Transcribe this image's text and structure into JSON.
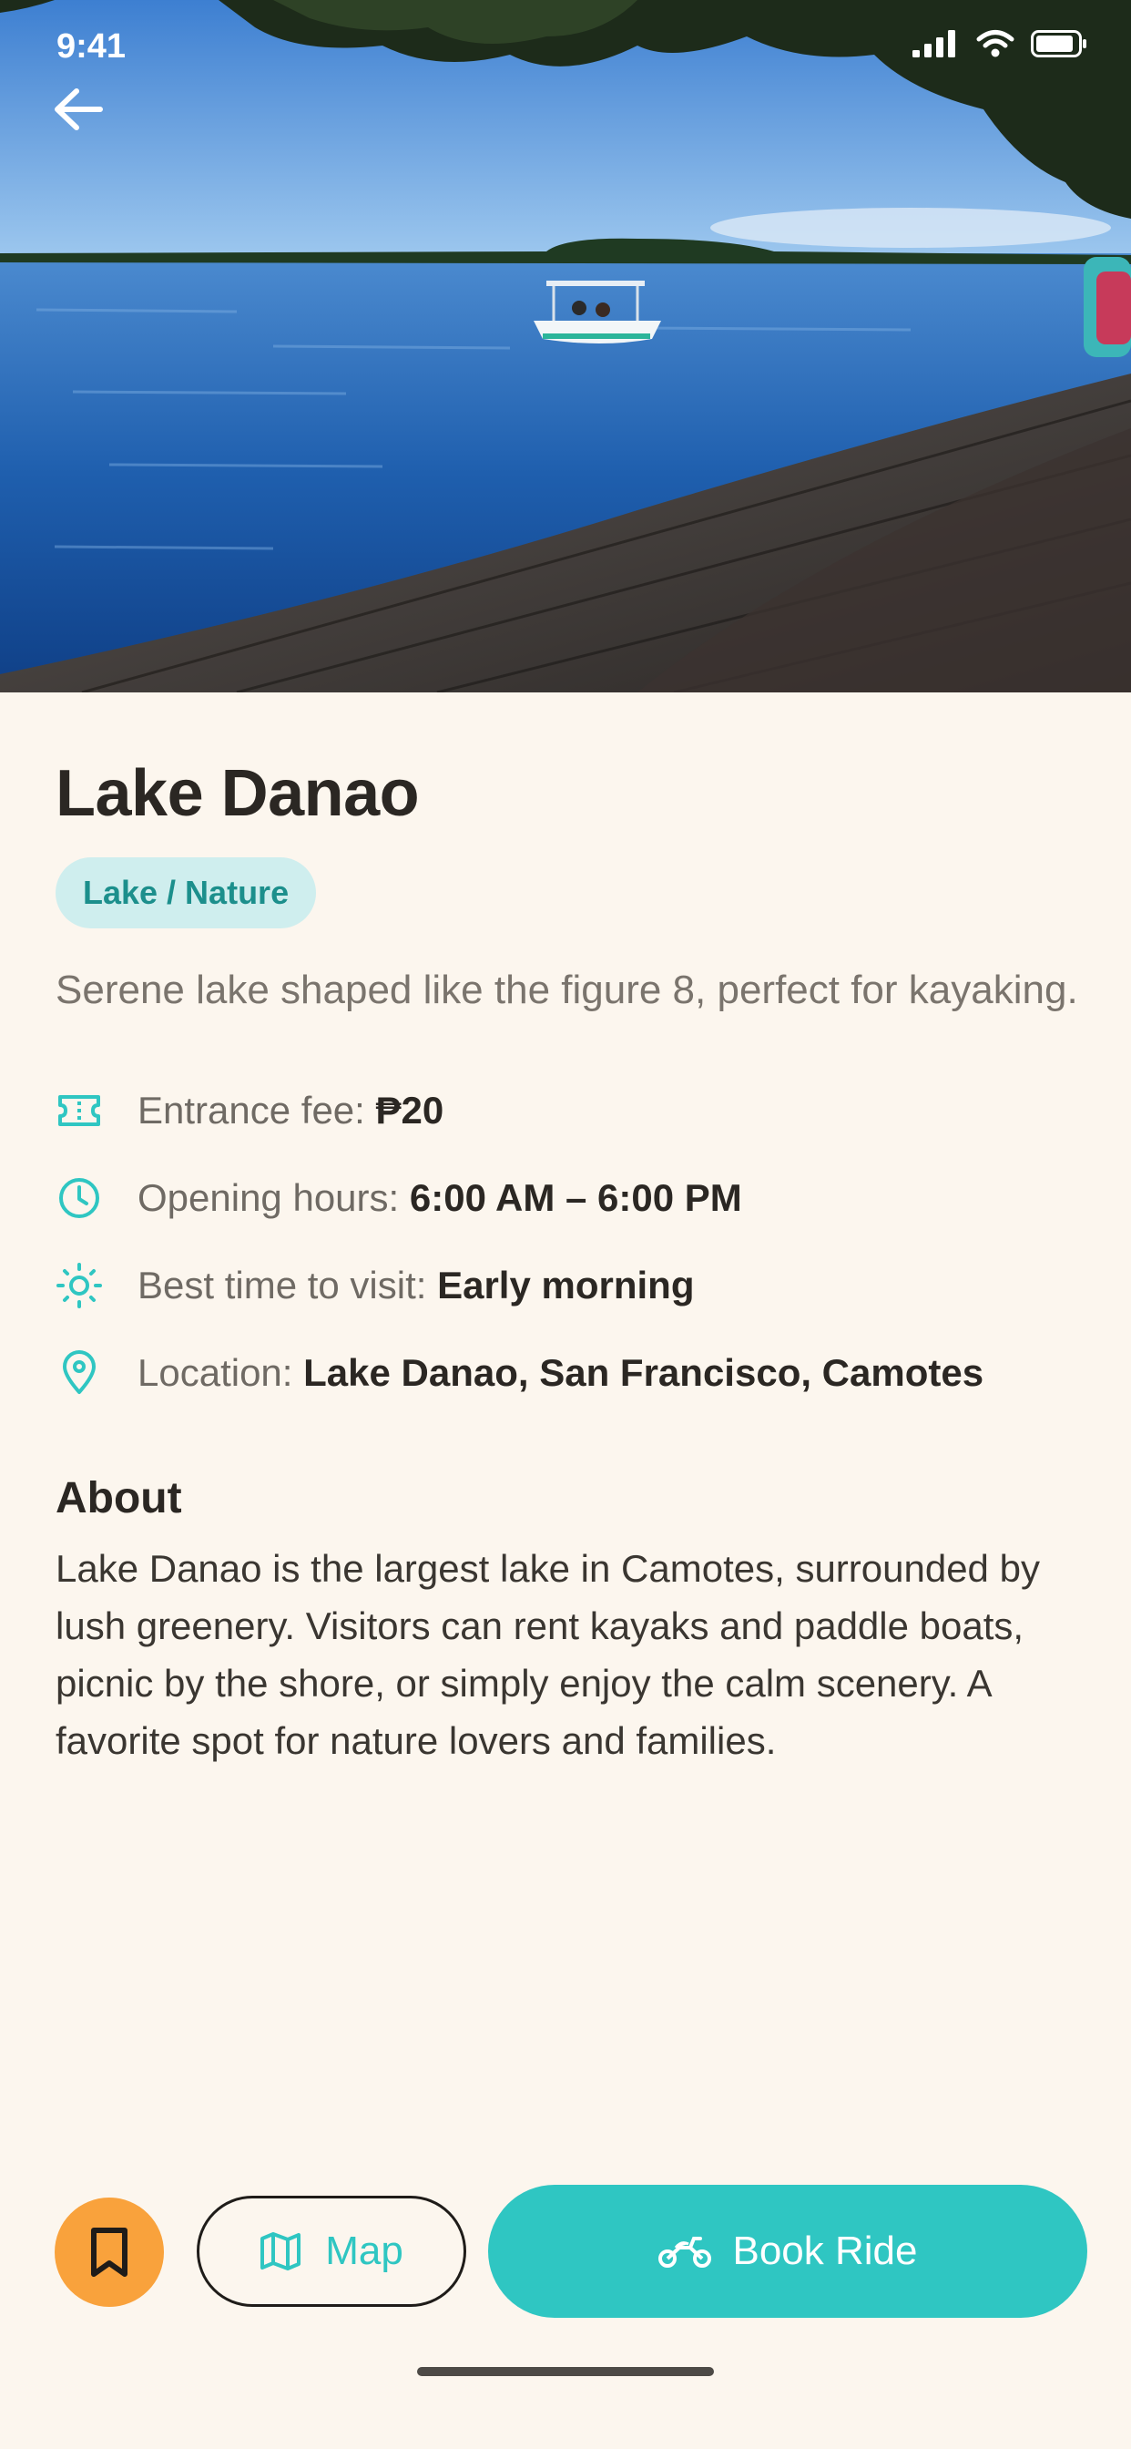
{
  "status_bar": {
    "time": "9:41"
  },
  "place": {
    "title": "Lake Danao",
    "category": "Lake / Nature",
    "description": "Serene lake shaped like the figure 8, perfect for kayaking."
  },
  "info": [
    {
      "icon": "ticket-icon",
      "label": "Entrance fee: ",
      "value": "₱20"
    },
    {
      "icon": "clock-icon",
      "label": "Opening hours: ",
      "value": "6:00 AM – 6:00 PM"
    },
    {
      "icon": "sun-icon",
      "label": "Best time to visit: ",
      "value": "Early morning"
    },
    {
      "icon": "location-pin-icon",
      "label": "Location: ",
      "value": "Lake Danao, San Francisco, Camotes"
    }
  ],
  "about": {
    "heading": "About",
    "text": "Lake Danao is the largest lake in Camotes, surrounded by lush greenery. Visitors can rent kayaks and paddle boats, picnic by the shore, or simply enjoy the calm scenery. A favorite spot for nature lovers and families."
  },
  "actions": {
    "map_label": "Map",
    "book_label": "Book Ride"
  },
  "colors": {
    "background": "#fcf6ee",
    "accent_teal": "#2fc6c2",
    "tag_bg": "#cfeeee",
    "bookmark_orange": "#f9a23c"
  }
}
